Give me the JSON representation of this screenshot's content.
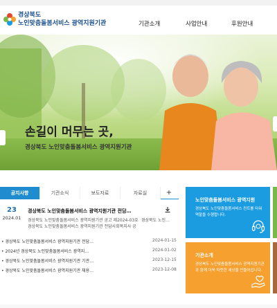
{
  "header": {
    "org_line1": "경상북도",
    "org_line2": "노인맞춤돌봄서비스 광역지원기관",
    "nav": [
      "기관소개",
      "사업안내",
      "후원안내"
    ]
  },
  "hero": {
    "title": "손길이 머무는 곳,",
    "subtitle": "경상북도 노인맞춤돌봄서비스 광역지원기관"
  },
  "notice": {
    "tabs": [
      "공지사항",
      "기관소식",
      "보도자료",
      "자료실"
    ],
    "plus": "+",
    "featured": {
      "day": "23",
      "year_month": "2024.01",
      "title": "경상북도 노인맞춤돌봄서비스 광역지원기관 전담…",
      "desc": "경상북도 노인맞춤돌봄서비스 광역지원기관 공고 제2024-03호 경상북도 노인맞춤돌봄서비스 광역지원기관 전담사회복지사 공개 채용 합격자 공고",
      "desc2": "경상북도 노인…"
    },
    "items": [
      {
        "title": "경상북도 노인맞춤돌봄서비스 광역지원기관 전담…",
        "date": "2024-01-15"
      },
      {
        "title": "2024년 경상북도 노인맞춤돌봄서비스 광역지…",
        "date": "2024-01-02"
      },
      {
        "title": "경상북도 노인맞춤돌봄서비스 광역지원기관 기관…",
        "date": "2023-12-15"
      },
      {
        "title": "경상북도 노인맞춤돌봄서비스 광역지원기관 채용…",
        "date": "2023-12-08"
      }
    ]
  },
  "cards": {
    "blue": {
      "title": "노인맞춤돌봄서비스 광역지원",
      "desc": "경상북도 노인맞춤돌봄서비스 컨트롤 타워 역할을 수행합니다.",
      "color": "#1b9be0"
    },
    "orange": {
      "title": "기관소개",
      "desc": "경상북도 노인맞춤돌봄서비스 광역지원기관과 함께 더욱 따뜻한 세상을 만들어갑니다.",
      "color": "#f5a02f"
    }
  },
  "colors": {
    "brand": "#1a4f8b",
    "accent": "#1e8ccf",
    "edge_green": "#7ab84a",
    "edge_brown": "#a5673b"
  },
  "icons": {
    "logo": "flower-logo-icon",
    "download": "download-icon",
    "support": "headset-icon",
    "care": "hand-heart-icon"
  }
}
